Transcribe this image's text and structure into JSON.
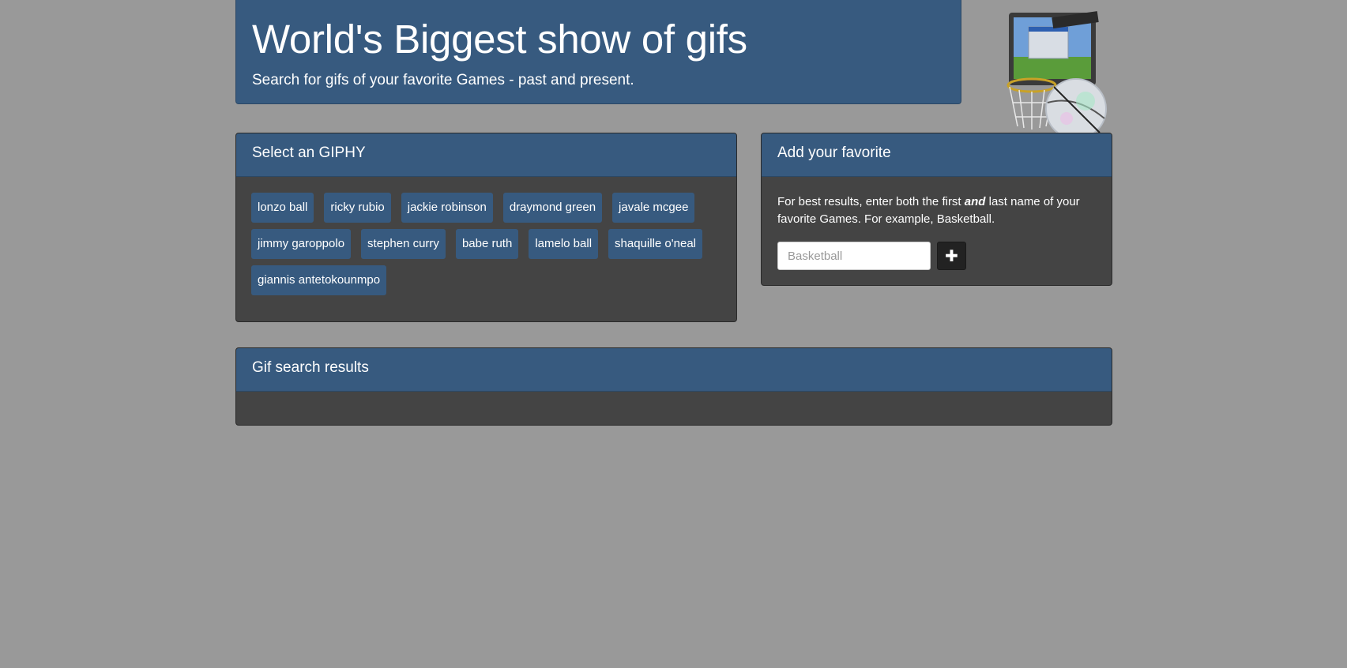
{
  "header": {
    "title": "World's Biggest show of gifs",
    "subtitle": "Search for gifs of your favorite Games - past and present."
  },
  "hero_image": {
    "icon": "computer-basketball-hoop-graphic"
  },
  "select_panel": {
    "title": "Select an GIPHY",
    "topics": [
      "lonzo ball",
      "ricky rubio",
      "jackie robinson",
      "draymond green",
      "javale mcgee",
      "jimmy garoppolo",
      "stephen curry",
      "babe ruth",
      "lamelo ball",
      "shaquille o'neal",
      "giannis antetokounmpo"
    ]
  },
  "add_panel": {
    "title": "Add your favorite",
    "help_before": "For best results, enter both the first ",
    "help_emphasis": "and",
    "help_after": " last name of your favorite Games. For example, Basketball.",
    "input_placeholder": "Basketball",
    "input_value": "",
    "add_icon": "plus-icon",
    "add_symbol": "✚"
  },
  "results_panel": {
    "title": "Gif search results"
  },
  "colors": {
    "page_background": "#999999",
    "primary": "#375a7f",
    "panel_body": "#444444",
    "dark_button": "#222222"
  }
}
